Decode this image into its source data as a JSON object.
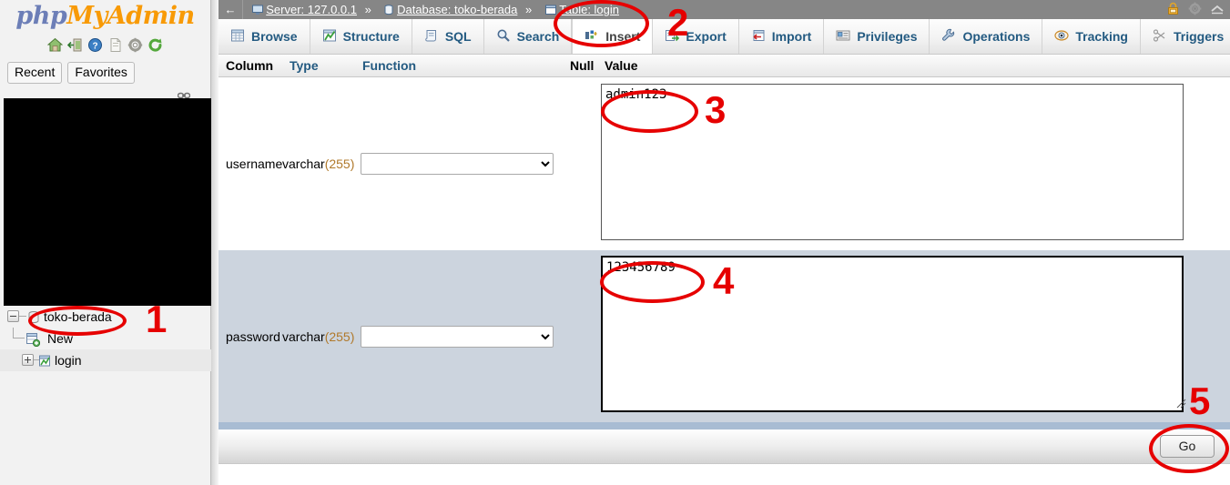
{
  "sidebar": {
    "logo": {
      "php": "php",
      "my": "My",
      "admin": "Admin"
    },
    "icons": [
      {
        "name": "home-icon",
        "label": "Home"
      },
      {
        "name": "logout-icon",
        "label": "Log out"
      },
      {
        "name": "help-icon",
        "label": "phpMyAdmin documentation"
      },
      {
        "name": "docs-icon",
        "label": "Documentation"
      },
      {
        "name": "settings-icon",
        "label": "Settings"
      },
      {
        "name": "reload-icon",
        "label": "Reload navigation"
      }
    ],
    "tabs": [
      {
        "label": "Recent"
      },
      {
        "label": "Favorites"
      }
    ],
    "chain_icon": "link-icon",
    "tree": [
      {
        "label": "toko-berada",
        "type": "database",
        "expander": "minus"
      },
      {
        "label": "New",
        "type": "new"
      },
      {
        "label": "login",
        "type": "table",
        "expander": "plus"
      }
    ]
  },
  "breadcrumb": {
    "back": "←",
    "server": "Server: 127.0.0.1",
    "database": "Database: toko-berada",
    "table": "Table: login",
    "separator": "»"
  },
  "topright_icons": [
    {
      "name": "lock-icon"
    },
    {
      "name": "gear-icon"
    },
    {
      "name": "collapse-icon"
    }
  ],
  "tabs": [
    {
      "label": "Browse",
      "icon": "browse-icon",
      "active": false
    },
    {
      "label": "Structure",
      "icon": "structure-icon",
      "active": false
    },
    {
      "label": "SQL",
      "icon": "sql-icon",
      "active": false
    },
    {
      "label": "Search",
      "icon": "search-icon",
      "active": false
    },
    {
      "label": "Insert",
      "icon": "insert-icon",
      "active": true
    },
    {
      "label": "Export",
      "icon": "export-icon",
      "active": false
    },
    {
      "label": "Import",
      "icon": "import-icon",
      "active": false
    },
    {
      "label": "Privileges",
      "icon": "privileges-icon",
      "active": false
    },
    {
      "label": "Operations",
      "icon": "operations-icon",
      "active": false
    },
    {
      "label": "Tracking",
      "icon": "tracking-icon",
      "active": false
    },
    {
      "label": "Triggers",
      "icon": "triggers-icon",
      "active": false
    }
  ],
  "table": {
    "headers": {
      "column": "Column",
      "type": "Type",
      "function": "Function",
      "null": "Null",
      "value": "Value"
    },
    "rows": [
      {
        "column": "username",
        "type_base": "varchar",
        "type_len": "(255)",
        "function_selected": "",
        "value": "admin123",
        "focused": false
      },
      {
        "column": "password",
        "type_base": "varchar",
        "type_len": "(255)",
        "function_selected": "",
        "value": "123456789",
        "focused": true
      }
    ]
  },
  "footer": {
    "go_label": "Go"
  },
  "annotations": [
    {
      "number": "1",
      "target": "sidebar-database-toko-berada"
    },
    {
      "number": "2",
      "target": "tab-insert"
    },
    {
      "number": "3",
      "target": "username-value-textarea"
    },
    {
      "number": "4",
      "target": "password-value-textarea"
    },
    {
      "number": "5",
      "target": "go-button"
    }
  ],
  "colors": {
    "annotation_red": "#e60000",
    "logo_blue": "#6c7eb7",
    "logo_orange": "#f89a06",
    "tab_link_blue": "#235a81",
    "selected_row_bg": "#ccd4de",
    "breadcrumb_bg": "#868686"
  }
}
